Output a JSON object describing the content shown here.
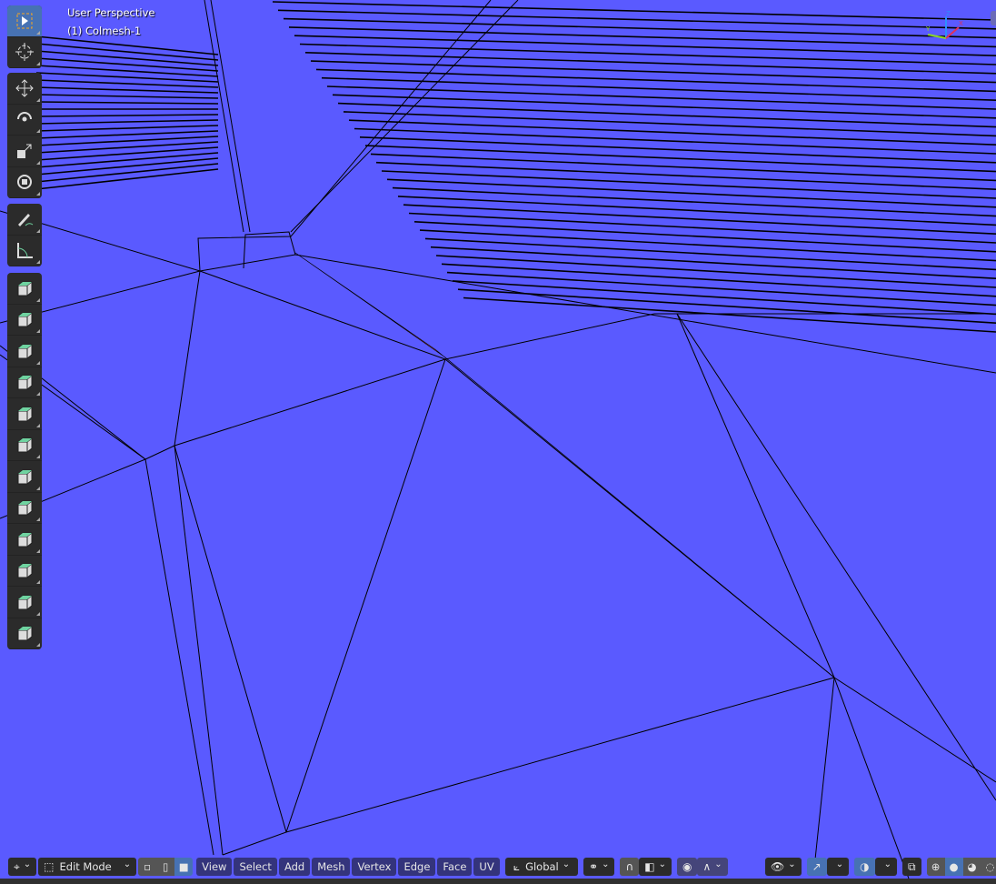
{
  "viewport": {
    "view_name": "User Perspective",
    "object_name": "(1) Colmesh-1",
    "background_color": "#5a5aff",
    "highlight_face_color": "#ff5a5a"
  },
  "toolbar": {
    "tools": [
      {
        "name": "select-box",
        "icon": "select-box-icon",
        "active": true
      },
      {
        "name": "cursor",
        "icon": "cursor-icon"
      },
      {
        "name": "move",
        "icon": "move-icon"
      },
      {
        "name": "rotate",
        "icon": "rotate-icon"
      },
      {
        "name": "scale",
        "icon": "scale-icon"
      },
      {
        "name": "transform",
        "icon": "transform-icon"
      },
      {
        "name": "annotate",
        "icon": "annotate-icon"
      },
      {
        "name": "measure",
        "icon": "measure-icon"
      },
      {
        "name": "extrude-region",
        "icon": "extrude-icon"
      },
      {
        "name": "inset-faces",
        "icon": "inset-icon"
      },
      {
        "name": "bevel",
        "icon": "bevel-icon"
      },
      {
        "name": "loop-cut",
        "icon": "loop-cut-icon"
      },
      {
        "name": "knife",
        "icon": "knife-icon"
      },
      {
        "name": "poly-build",
        "icon": "poly-build-icon"
      },
      {
        "name": "spin",
        "icon": "spin-icon"
      },
      {
        "name": "smooth",
        "icon": "smooth-icon"
      },
      {
        "name": "edge-slide",
        "icon": "edge-slide-icon"
      },
      {
        "name": "shrink-fatten",
        "icon": "shrink-fatten-icon"
      },
      {
        "name": "shear",
        "icon": "shear-icon"
      },
      {
        "name": "rip-region",
        "icon": "rip-icon"
      }
    ]
  },
  "header": {
    "mode": "Edit Mode",
    "menus": [
      "View",
      "Select",
      "Add",
      "Mesh",
      "Vertex",
      "Edge",
      "Face",
      "UV"
    ],
    "transform_orientation": "Global",
    "select_mode_active": "face",
    "shading_active": "solid"
  },
  "gizmo": {
    "x": "X",
    "y": "Y",
    "z": "Z"
  }
}
